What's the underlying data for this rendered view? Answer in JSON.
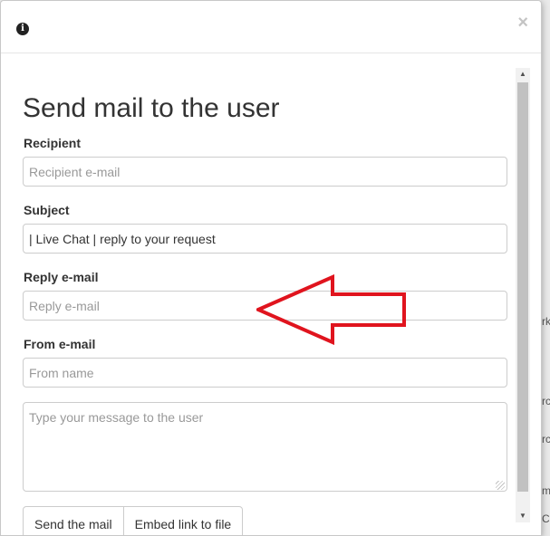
{
  "header": {
    "info_icon": "info-icon",
    "close_label": "×"
  },
  "form": {
    "title": "Send mail to the user",
    "recipient": {
      "label": "Recipient",
      "placeholder": "Recipient e-mail",
      "value": ""
    },
    "subject": {
      "label": "Subject",
      "placeholder": "",
      "value": "| Live Chat | reply to your request"
    },
    "reply": {
      "label": "Reply e-mail",
      "placeholder": "Reply e-mail",
      "value": ""
    },
    "from": {
      "label": "From e-mail",
      "placeholder": "From name",
      "value": ""
    },
    "message": {
      "placeholder": "Type your message to the user"
    },
    "buttons": {
      "send": "Send the mail",
      "embed": "Embed link to file"
    }
  },
  "annotation": {
    "arrow_color": "#e0141e",
    "icon": "left-arrow-annotation"
  },
  "background": {
    "snips": [
      "rk",
      "rc",
      "rc",
      "m",
      "C"
    ]
  }
}
